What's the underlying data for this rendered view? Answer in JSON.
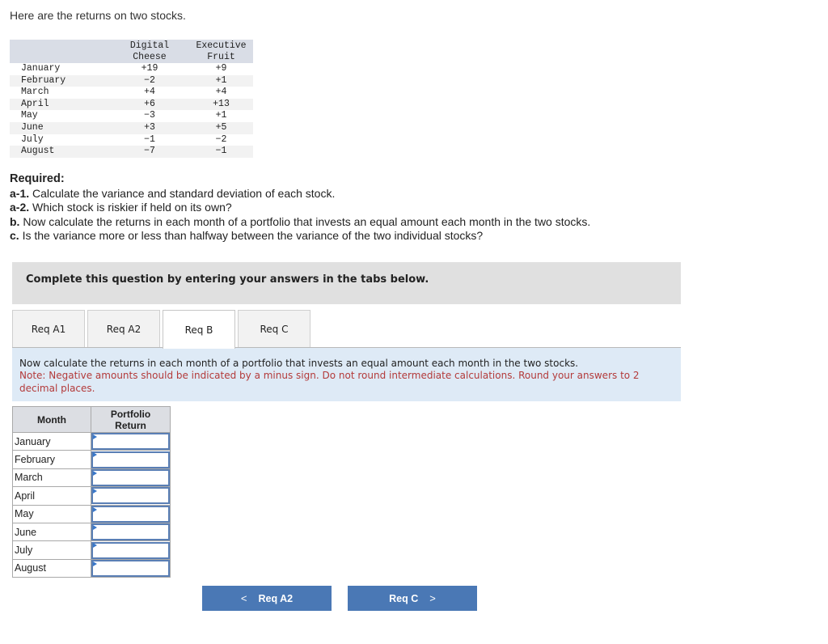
{
  "intro": "Here are the returns on two stocks.",
  "stock_table": {
    "headers": [
      "",
      "Digital\nCheese",
      "Executive\nFruit"
    ],
    "header_lines": {
      "col1": [
        "Digital",
        "Cheese"
      ],
      "col2": [
        "Executive",
        "Fruit"
      ]
    },
    "rows": [
      {
        "month": "January",
        "digital_cheese": "+19",
        "executive_fruit": "+9"
      },
      {
        "month": "February",
        "digital_cheese": "−2",
        "executive_fruit": "+1"
      },
      {
        "month": "March",
        "digital_cheese": "+4",
        "executive_fruit": "+4"
      },
      {
        "month": "April",
        "digital_cheese": "+6",
        "executive_fruit": "+13"
      },
      {
        "month": "May",
        "digital_cheese": "−3",
        "executive_fruit": "+1"
      },
      {
        "month": "June",
        "digital_cheese": "+3",
        "executive_fruit": "+5"
      },
      {
        "month": "July",
        "digital_cheese": "−1",
        "executive_fruit": "−2"
      },
      {
        "month": "August",
        "digital_cheese": "−7",
        "executive_fruit": "−1"
      }
    ]
  },
  "required": {
    "heading": "Required:",
    "items": [
      {
        "label": "a-1.",
        "text": " Calculate the variance and standard deviation of each stock."
      },
      {
        "label": "a-2.",
        "text": " Which stock is riskier if held on its own?"
      },
      {
        "label": "b.",
        "text": " Now calculate the returns in each month of a portfolio that invests an equal amount each month in the two stocks."
      },
      {
        "label": "c.",
        "text": " Is the variance more or less than halfway between the variance of the two individual stocks?"
      }
    ]
  },
  "instructions": "Complete this question by entering your answers in the tabs below.",
  "tabs": [
    {
      "label": "Req A1",
      "active": false
    },
    {
      "label": "Req A2",
      "active": false
    },
    {
      "label": "Req B",
      "active": true
    },
    {
      "label": "Req C",
      "active": false
    }
  ],
  "note": {
    "question": "Now calculate the returns in each month of a portfolio that invests an equal amount each month in the two stocks.",
    "warning": "Note: Negative amounts should be indicated by a minus sign. Do not round intermediate calculations. Round your answers to 2 decimal places.",
    "warning_color": "#b33a3a"
  },
  "answer_table": {
    "headers": {
      "month": "Month",
      "return_line1": "Portfolio",
      "return_line2": "Return"
    },
    "rows": [
      {
        "month": "January",
        "value": ""
      },
      {
        "month": "February",
        "value": ""
      },
      {
        "month": "March",
        "value": ""
      },
      {
        "month": "April",
        "value": ""
      },
      {
        "month": "May",
        "value": ""
      },
      {
        "month": "June",
        "value": ""
      },
      {
        "month": "July",
        "value": ""
      },
      {
        "month": "August",
        "value": ""
      }
    ]
  },
  "nav": {
    "prev_label": "Req A2",
    "prev_icon": "chevron-left-icon",
    "next_label": "Req C",
    "next_icon": "chevron-right-icon",
    "button_color": "#4a78b5"
  }
}
